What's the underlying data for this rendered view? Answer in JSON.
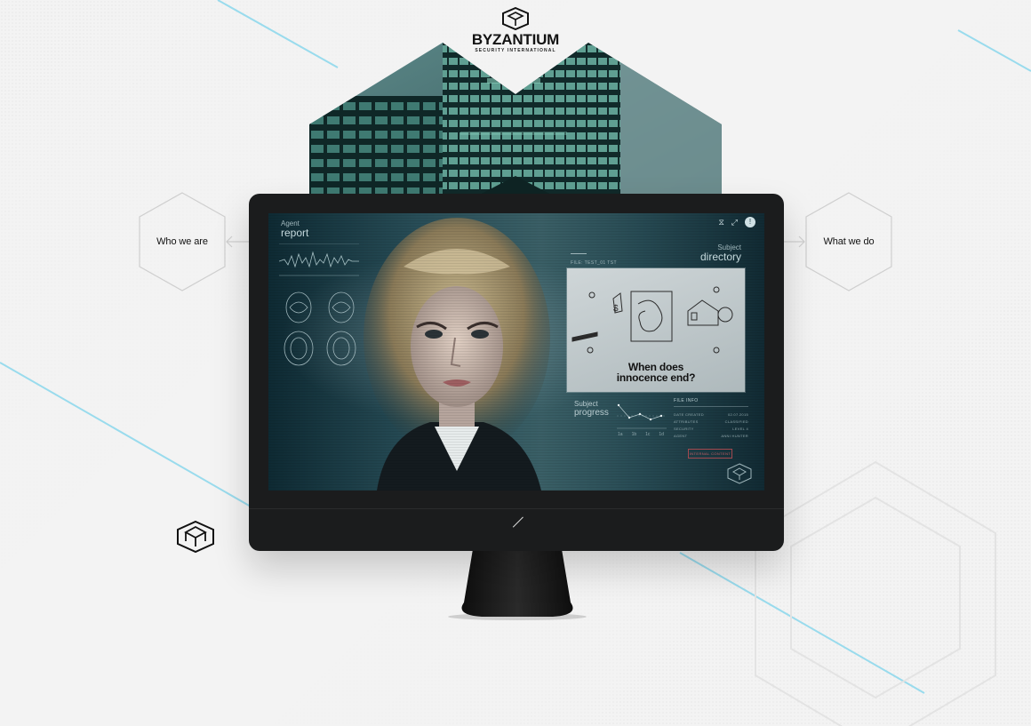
{
  "brand": {
    "name": "BYZANTIUM",
    "tagline": "SECURITY INTERNATIONAL",
    "logo_icon": "cube-hex-logo-icon"
  },
  "nav": {
    "left": {
      "label": "Who we are",
      "icon": "arrow-left-icon"
    },
    "right": {
      "label": "What we do",
      "icon": "arrow-right-icon"
    }
  },
  "screen": {
    "agent_report": {
      "small": "Agent",
      "big": "report"
    },
    "subject_directory": {
      "small": "Subject",
      "big": "directory"
    },
    "file_label": "FILE: TEST_01 TST",
    "card_headline_line1": "When does",
    "card_headline_line2": "innocence end?",
    "subject_progress": {
      "small": "Subject",
      "big": "progress"
    },
    "progress_ticks": [
      "1a",
      "1b",
      "1c",
      "1d"
    ],
    "file_info": {
      "title": "FILE INFO",
      "rows": [
        {
          "k": "DATE CREATED",
          "v": "02.07.2015"
        },
        {
          "k": "ATTRIBUTES",
          "v": "CLASSIFIED"
        },
        {
          "k": "SECURITY",
          "v": "LEVEL 4"
        },
        {
          "k": "AGENT",
          "v": "ANNI HUNTER"
        }
      ],
      "button": "INTERNAL CONTENT"
    },
    "controls": {
      "share": "⧖",
      "expand": "⤢",
      "user": "!"
    }
  },
  "colors": {
    "accent_line": "#8fd8ec",
    "background": "#f3f3f3",
    "monitor": "#1b1c1d",
    "screen_tint": "#284d57",
    "alert": "#c45c63"
  }
}
